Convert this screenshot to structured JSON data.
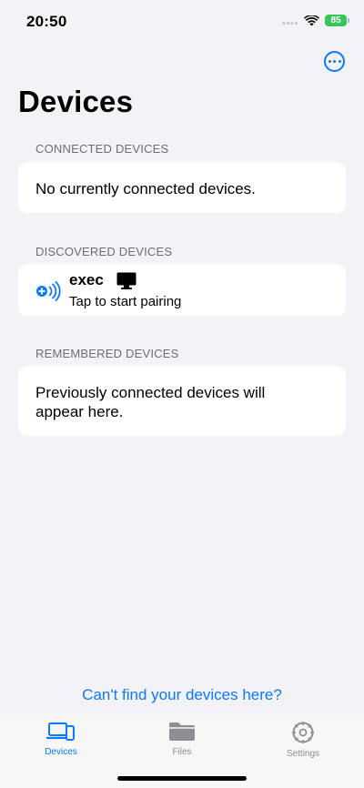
{
  "status_bar": {
    "time": "20:50",
    "battery": "85"
  },
  "header": {
    "title": "Devices"
  },
  "sections": {
    "connected": {
      "header": "CONNECTED DEVICES",
      "empty_text": "No currently connected devices."
    },
    "discovered": {
      "header": "DISCOVERED DEVICES",
      "devices": [
        {
          "name": "exec",
          "subtitle": "Tap to start pairing"
        }
      ]
    },
    "remembered": {
      "header": "REMEMBERED DEVICES",
      "empty_line1": "Previously connected devices will",
      "empty_line2": "appear here."
    }
  },
  "help_link": "Can't find your devices here?",
  "tab_bar": {
    "tabs": [
      {
        "label": "Devices",
        "icon": "laptop-phone-icon",
        "selected": true
      },
      {
        "label": "Files",
        "icon": "folder-icon",
        "selected": false
      },
      {
        "label": "Settings",
        "icon": "gear-icon",
        "selected": false
      }
    ]
  },
  "colors": {
    "accent": "#0a7aff",
    "background": "#f2f2f7",
    "battery": "#35c759",
    "secondary_text": "#6d6d72"
  }
}
